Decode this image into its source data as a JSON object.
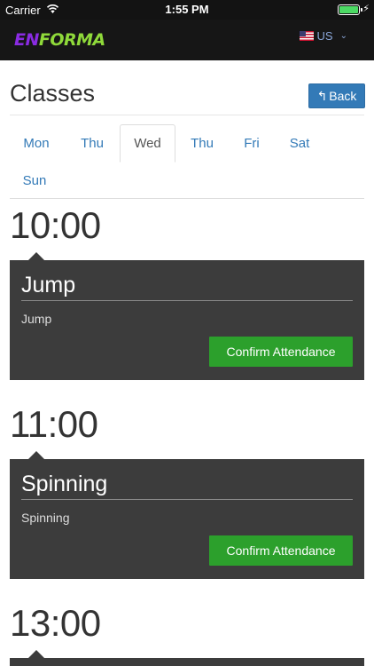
{
  "status_bar": {
    "carrier": "Carrier",
    "time": "1:55 PM"
  },
  "header": {
    "logo_en": "EN",
    "logo_forma": "FORMA",
    "locale": "US"
  },
  "page": {
    "title": "Classes",
    "back_label": "Back"
  },
  "days": [
    {
      "label": "Mon",
      "active": false
    },
    {
      "label": "Thu",
      "active": false
    },
    {
      "label": "Wed",
      "active": true
    },
    {
      "label": "Thu",
      "active": false
    },
    {
      "label": "Fri",
      "active": false
    },
    {
      "label": "Sat",
      "active": false
    },
    {
      "label": "Sun",
      "active": false
    }
  ],
  "classes": [
    {
      "time": "10:00",
      "name": "Jump",
      "description": "Jump",
      "button": "Confirm Attendance"
    },
    {
      "time": "11:00",
      "name": "Spinning",
      "description": "Spinning",
      "button": "Confirm Attendance"
    },
    {
      "time": "13:00"
    }
  ],
  "colors": {
    "brand_purple": "#8a2be2",
    "brand_green": "#8fd93a",
    "primary": "#337ab7",
    "confirm_green": "#2ca02c",
    "card_bg": "#3c3c3c"
  }
}
